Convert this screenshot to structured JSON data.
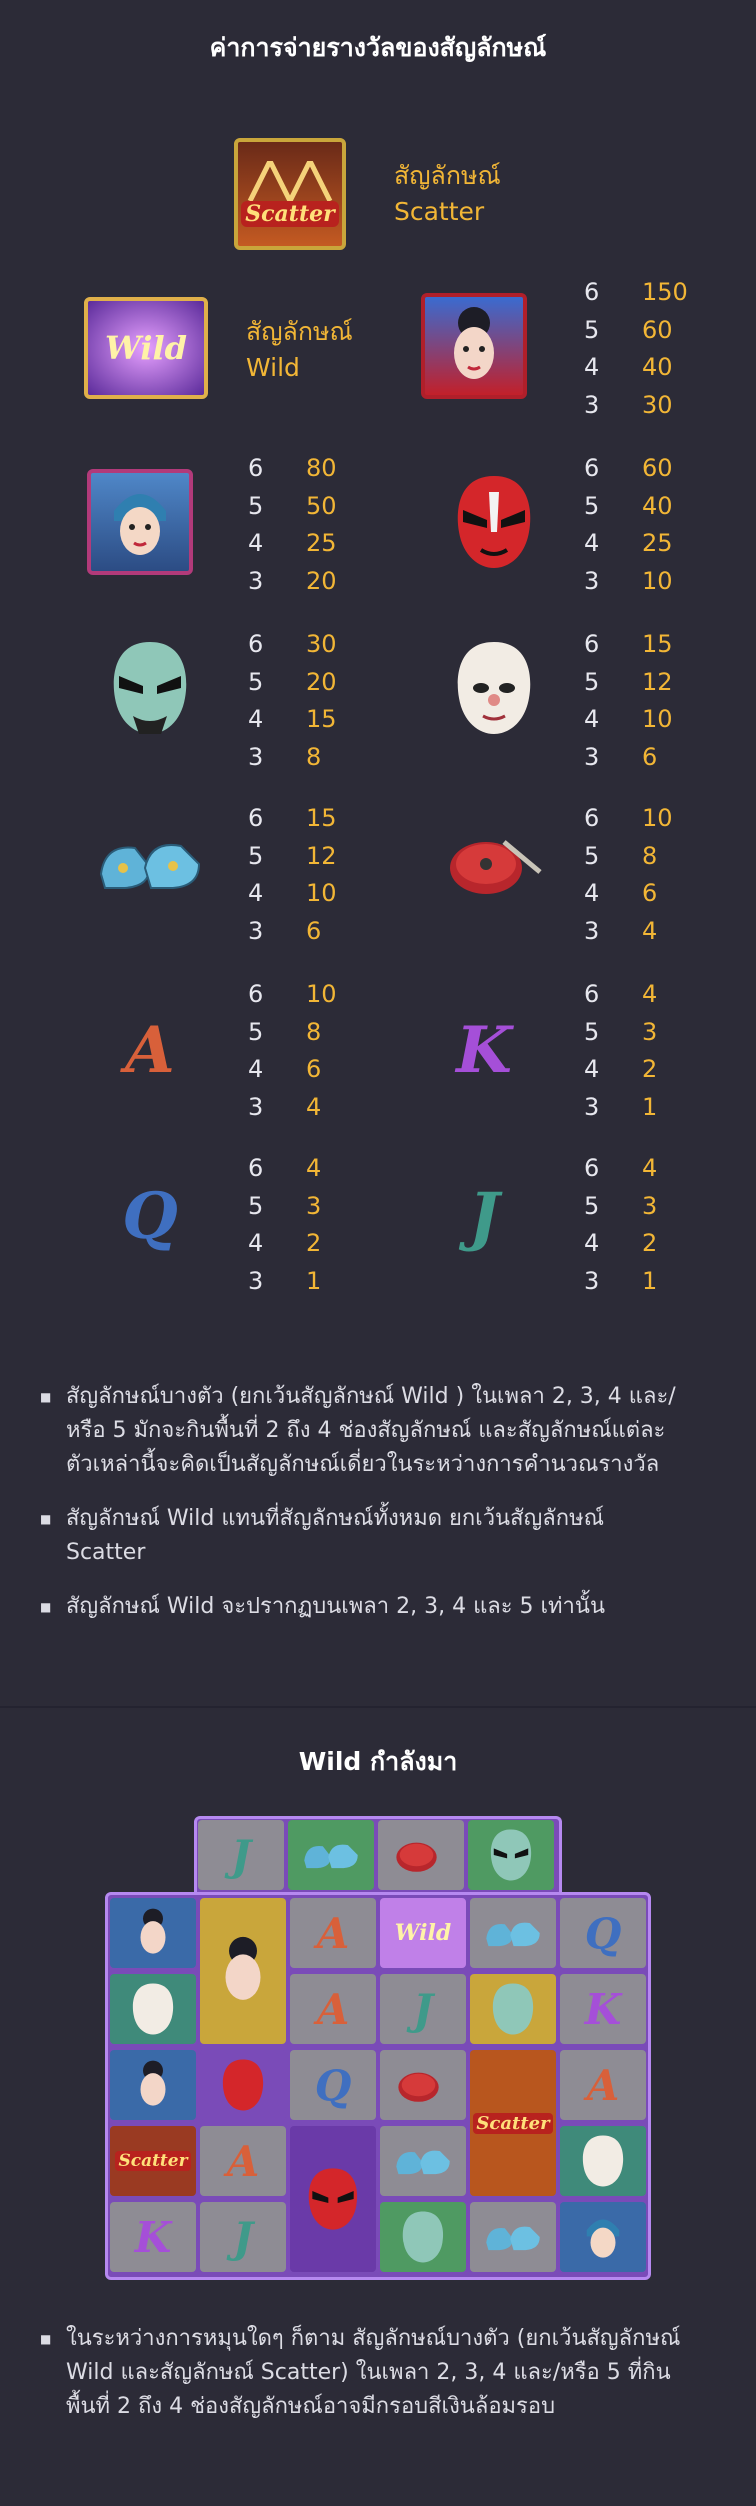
{
  "paytable": {
    "title": "ค่าการจ่ายรางวัลของสัญลักษณ์",
    "scatter": {
      "label_line1": "สัญลักษณ์",
      "label_line2": "Scatter",
      "icon_text": "Scatter"
    },
    "wild": {
      "label_line1": "สัญลักษณ์",
      "label_line2": "Wild",
      "icon_text": "Wild"
    },
    "symbols": [
      {
        "id": "opera-lady",
        "pays": [
          [
            "6",
            "150"
          ],
          [
            "5",
            "60"
          ],
          [
            "4",
            "40"
          ],
          [
            "3",
            "30"
          ]
        ]
      },
      {
        "id": "girl",
        "pays": [
          [
            "6",
            "80"
          ],
          [
            "5",
            "50"
          ],
          [
            "4",
            "25"
          ],
          [
            "3",
            "20"
          ]
        ]
      },
      {
        "id": "red-mask",
        "pays": [
          [
            "6",
            "60"
          ],
          [
            "5",
            "40"
          ],
          [
            "4",
            "25"
          ],
          [
            "3",
            "10"
          ]
        ]
      },
      {
        "id": "green-mask",
        "pays": [
          [
            "6",
            "30"
          ],
          [
            "5",
            "20"
          ],
          [
            "4",
            "15"
          ],
          [
            "3",
            "8"
          ]
        ]
      },
      {
        "id": "white-mask",
        "pays": [
          [
            "6",
            "15"
          ],
          [
            "5",
            "12"
          ],
          [
            "4",
            "10"
          ],
          [
            "3",
            "6"
          ]
        ]
      },
      {
        "id": "shoes",
        "pays": [
          [
            "6",
            "15"
          ],
          [
            "5",
            "12"
          ],
          [
            "4",
            "10"
          ],
          [
            "3",
            "6"
          ]
        ]
      },
      {
        "id": "drum",
        "pays": [
          [
            "6",
            "10"
          ],
          [
            "5",
            "8"
          ],
          [
            "4",
            "6"
          ],
          [
            "3",
            "4"
          ]
        ]
      },
      {
        "id": "A",
        "letter": "A",
        "pays": [
          [
            "6",
            "10"
          ],
          [
            "5",
            "8"
          ],
          [
            "4",
            "6"
          ],
          [
            "3",
            "4"
          ]
        ]
      },
      {
        "id": "K",
        "letter": "K",
        "pays": [
          [
            "6",
            "4"
          ],
          [
            "5",
            "3"
          ],
          [
            "4",
            "2"
          ],
          [
            "3",
            "1"
          ]
        ]
      },
      {
        "id": "Q",
        "letter": "Q",
        "pays": [
          [
            "6",
            "4"
          ],
          [
            "5",
            "3"
          ],
          [
            "4",
            "2"
          ],
          [
            "3",
            "1"
          ]
        ]
      },
      {
        "id": "J",
        "letter": "J",
        "pays": [
          [
            "6",
            "4"
          ],
          [
            "5",
            "3"
          ],
          [
            "4",
            "2"
          ],
          [
            "3",
            "1"
          ]
        ]
      }
    ]
  },
  "notes": [
    "สัญลักษณ์บางตัว (ยกเว้นสัญลักษณ์ Wild ) ในเพลา 2, 3, 4 และ/หรือ 5 มักจะกินพื้นที่ 2 ถึง 4 ช่องสัญลักษณ์ และสัญลักษณ์แต่ละตัวเหล่านี้จะคิดเป็นสัญลักษณ์เดี่ยวในระหว่างการคำนวณรางวัล",
    "สัญลักษณ์ Wild แทนที่สัญลักษณ์ทั้งหมด ยกเว้นสัญลักษณ์ Scatter",
    "สัญลักษณ์ Wild จะปรากฏบนเพลา 2, 3, 4 และ 5 เท่านั้น"
  ],
  "wild_section": {
    "title": "Wild กำลังมา",
    "note": "ในระหว่างการหมุนใดๆ ก็ตาม สัญลักษณ์บางตัว (ยกเว้นสัญลักษณ์ Wild และสัญลักษณ์ Scatter) ในเพลา 2, 3, 4 และ/หรือ 5 ที่กินพื้นที่ 2 ถึง 4 ช่องสัญลักษณ์อาจมีกรอบสีเงินล้อมรอบ",
    "grid_letters": {
      "a": "A",
      "k": "K",
      "q": "Q",
      "j": "J"
    },
    "grid_scatter": "Scatter",
    "grid_wild": "Wild"
  },
  "colors": {
    "background": "#2c2b37",
    "accent": "#f2b636",
    "grid": "#7a4bb8"
  }
}
